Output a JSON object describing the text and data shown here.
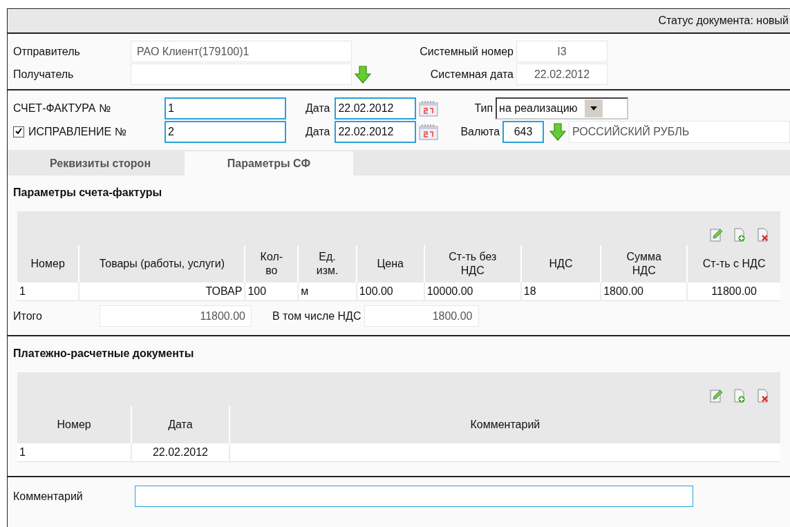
{
  "status_bar": {
    "text": "Статус документа: новый"
  },
  "parties": {
    "sender": {
      "label": "Отправитель",
      "value": "РАО Клиент(179100)1"
    },
    "recipient": {
      "label": "Получатель"
    },
    "system_number": {
      "label": "Системный номер",
      "value": "I3"
    },
    "system_date": {
      "label": "Системная дата",
      "value": "22.02.2012"
    }
  },
  "invoice": {
    "number_label": "СЧЕТ-ФАКТУРА №",
    "number": "1",
    "correction": {
      "label": "ИСПРАВЛЕНИЕ №",
      "checked": true,
      "number": "2"
    },
    "date_label_1": "Дата",
    "date_1": "22.02.2012",
    "date_label_2": "Дата",
    "date_2": "22.02.2012",
    "type_label": "Тип",
    "type": "на реализацию",
    "currency_label": "Валюта",
    "currency_code": "643",
    "currency_name": "РОССИЙСКИЙ РУБЛЬ"
  },
  "tabs": [
    {
      "label": "Реквизиты сторон",
      "selected": false
    },
    {
      "label": "Параметры СФ",
      "selected": true
    }
  ],
  "params": {
    "title": "Параметры счета-фактуры",
    "table": {
      "columns": [
        "Номер",
        "Товары (работы, услуги)",
        "Кол-\nво",
        "Ед.\nизм.",
        "Цена",
        "Ст-ть без\nНДС",
        "НДС",
        "Сумма\nНДС",
        "Ст-ть с НДС"
      ],
      "rows": [
        [
          "1",
          "ТОВАР",
          "100",
          "м",
          "100.00",
          "10000.00",
          "18",
          "1800.00",
          "11800.00"
        ]
      ]
    },
    "total_label": "Итого",
    "total": "11800.00",
    "vat_label": "В том числе НДС",
    "vat": "1800.00"
  },
  "payments": {
    "title": "Платежно-расчетные документы",
    "table": {
      "columns": [
        "Номер",
        "Дата",
        "Комментарий"
      ],
      "rows": [
        [
          "1",
          "22.02.2012",
          ""
        ]
      ]
    }
  },
  "comment": {
    "label": "Комментарий"
  }
}
